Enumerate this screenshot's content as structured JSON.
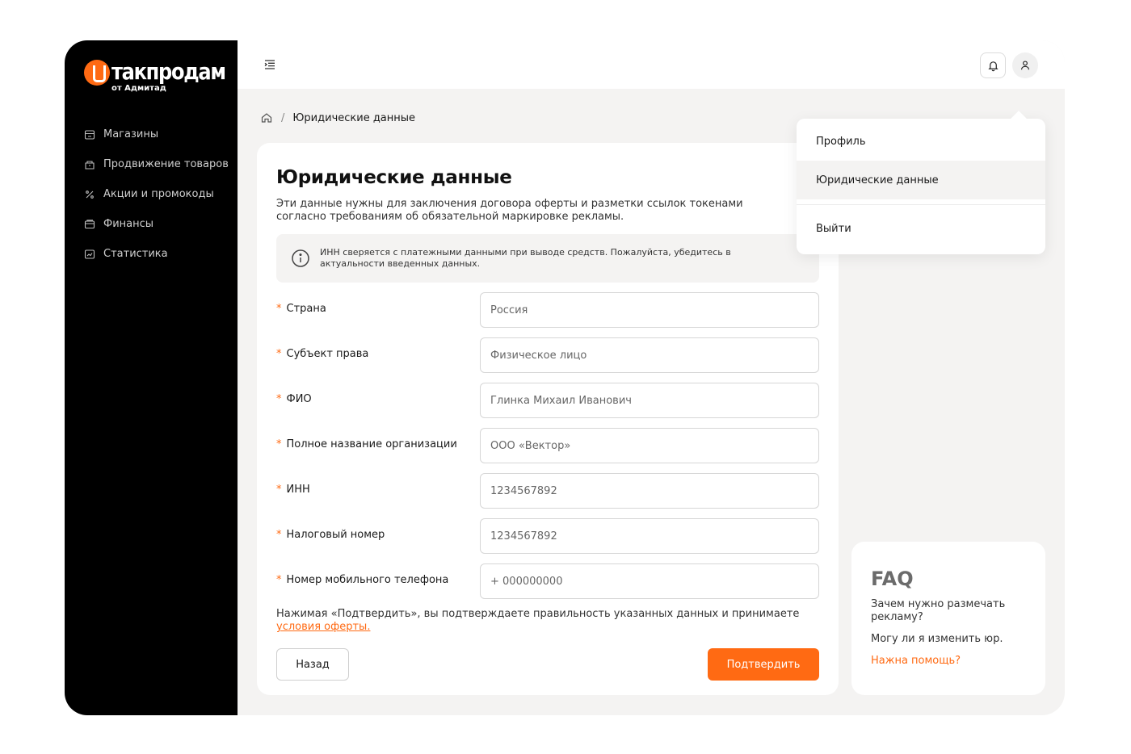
{
  "brand": {
    "name": "такпродам",
    "subtitle": "от Адмитад",
    "accent": "#ff6a13"
  },
  "sidebar": {
    "items": [
      {
        "label": "Магазины",
        "icon": "store-icon"
      },
      {
        "label": "Продвижение товаров",
        "icon": "promo-icon"
      },
      {
        "label": "Акции и промокоды",
        "icon": "percent-icon"
      },
      {
        "label": "Финансы",
        "icon": "wallet-icon"
      },
      {
        "label": "Статистика",
        "icon": "chart-icon"
      }
    ]
  },
  "breadcrumb": {
    "current": "Юридические данные",
    "separator": "/"
  },
  "page": {
    "title": "Юридические данные",
    "subtitle": "Эти данные нужны для заключения договора оферты и разметки ссылок токенами согласно требованиям об обязательной маркировке рекламы.",
    "info": "ИНН сверяется с платежными данными при выводе средств. Пожалуйста, убедитесь в актуальности введенных данных."
  },
  "form": {
    "required_mark": "*",
    "fields": [
      {
        "label": "Страна",
        "value": "Россия"
      },
      {
        "label": "Субъект права",
        "value": "Физическое лицо"
      },
      {
        "label": "ФИО",
        "value": "Глинка Михаил Иванович"
      },
      {
        "label": "Полное название организации",
        "value": "ООО «Вектор»"
      },
      {
        "label": "ИНН",
        "value": "1234567892"
      },
      {
        "label": "Налоговый номер",
        "value": "1234567892"
      },
      {
        "label": "Номер мобильного телефона",
        "value": "+ 000000000"
      }
    ],
    "consent_text": "Нажимая «Подтвердить», вы подтверждаете правильность указанных данных и принимаете ",
    "consent_link": "условия оферты.",
    "back_label": "Назад",
    "submit_label": "Подтвердить"
  },
  "dropdown": {
    "items": [
      {
        "label": "Профиль"
      },
      {
        "label": "Юридические данные",
        "active": true
      },
      {
        "label": "Выйти"
      }
    ]
  },
  "faq": {
    "title": "FAQ",
    "questions": [
      "Зачем нужно размечать рекламу?",
      "Могу ли я изменить юр."
    ],
    "help_label": "Нажна помощь?"
  }
}
